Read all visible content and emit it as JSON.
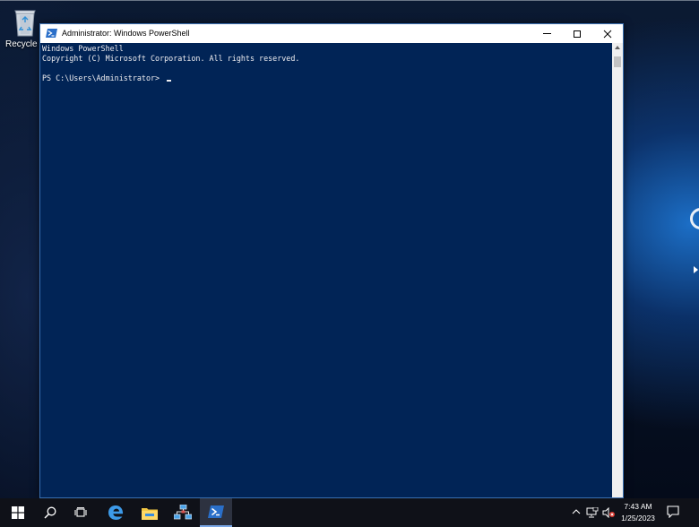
{
  "desktop": {
    "recycle_bin_label": "Recycle Bin"
  },
  "window": {
    "title": "Administrator: Windows PowerShell",
    "controls": [
      "minimize",
      "maximize",
      "close"
    ],
    "console_background": "#012456",
    "console_text_color": "#eeedf0"
  },
  "console": {
    "lines": [
      "Windows PowerShell",
      "Copyright (C) Microsoft Corporation. All rights reserved.",
      "PS C:\\Users\\Administrator> "
    ]
  },
  "taskbar": {
    "items": [
      "start-icon",
      "search-icon",
      "task-view-icon",
      "edge-browser-icon",
      "file-explorer-icon",
      "network-icon",
      "powershell-icon"
    ],
    "active_item": "powershell-icon",
    "clock_time": "7:43 AM",
    "clock_date": "1/25/2023"
  }
}
